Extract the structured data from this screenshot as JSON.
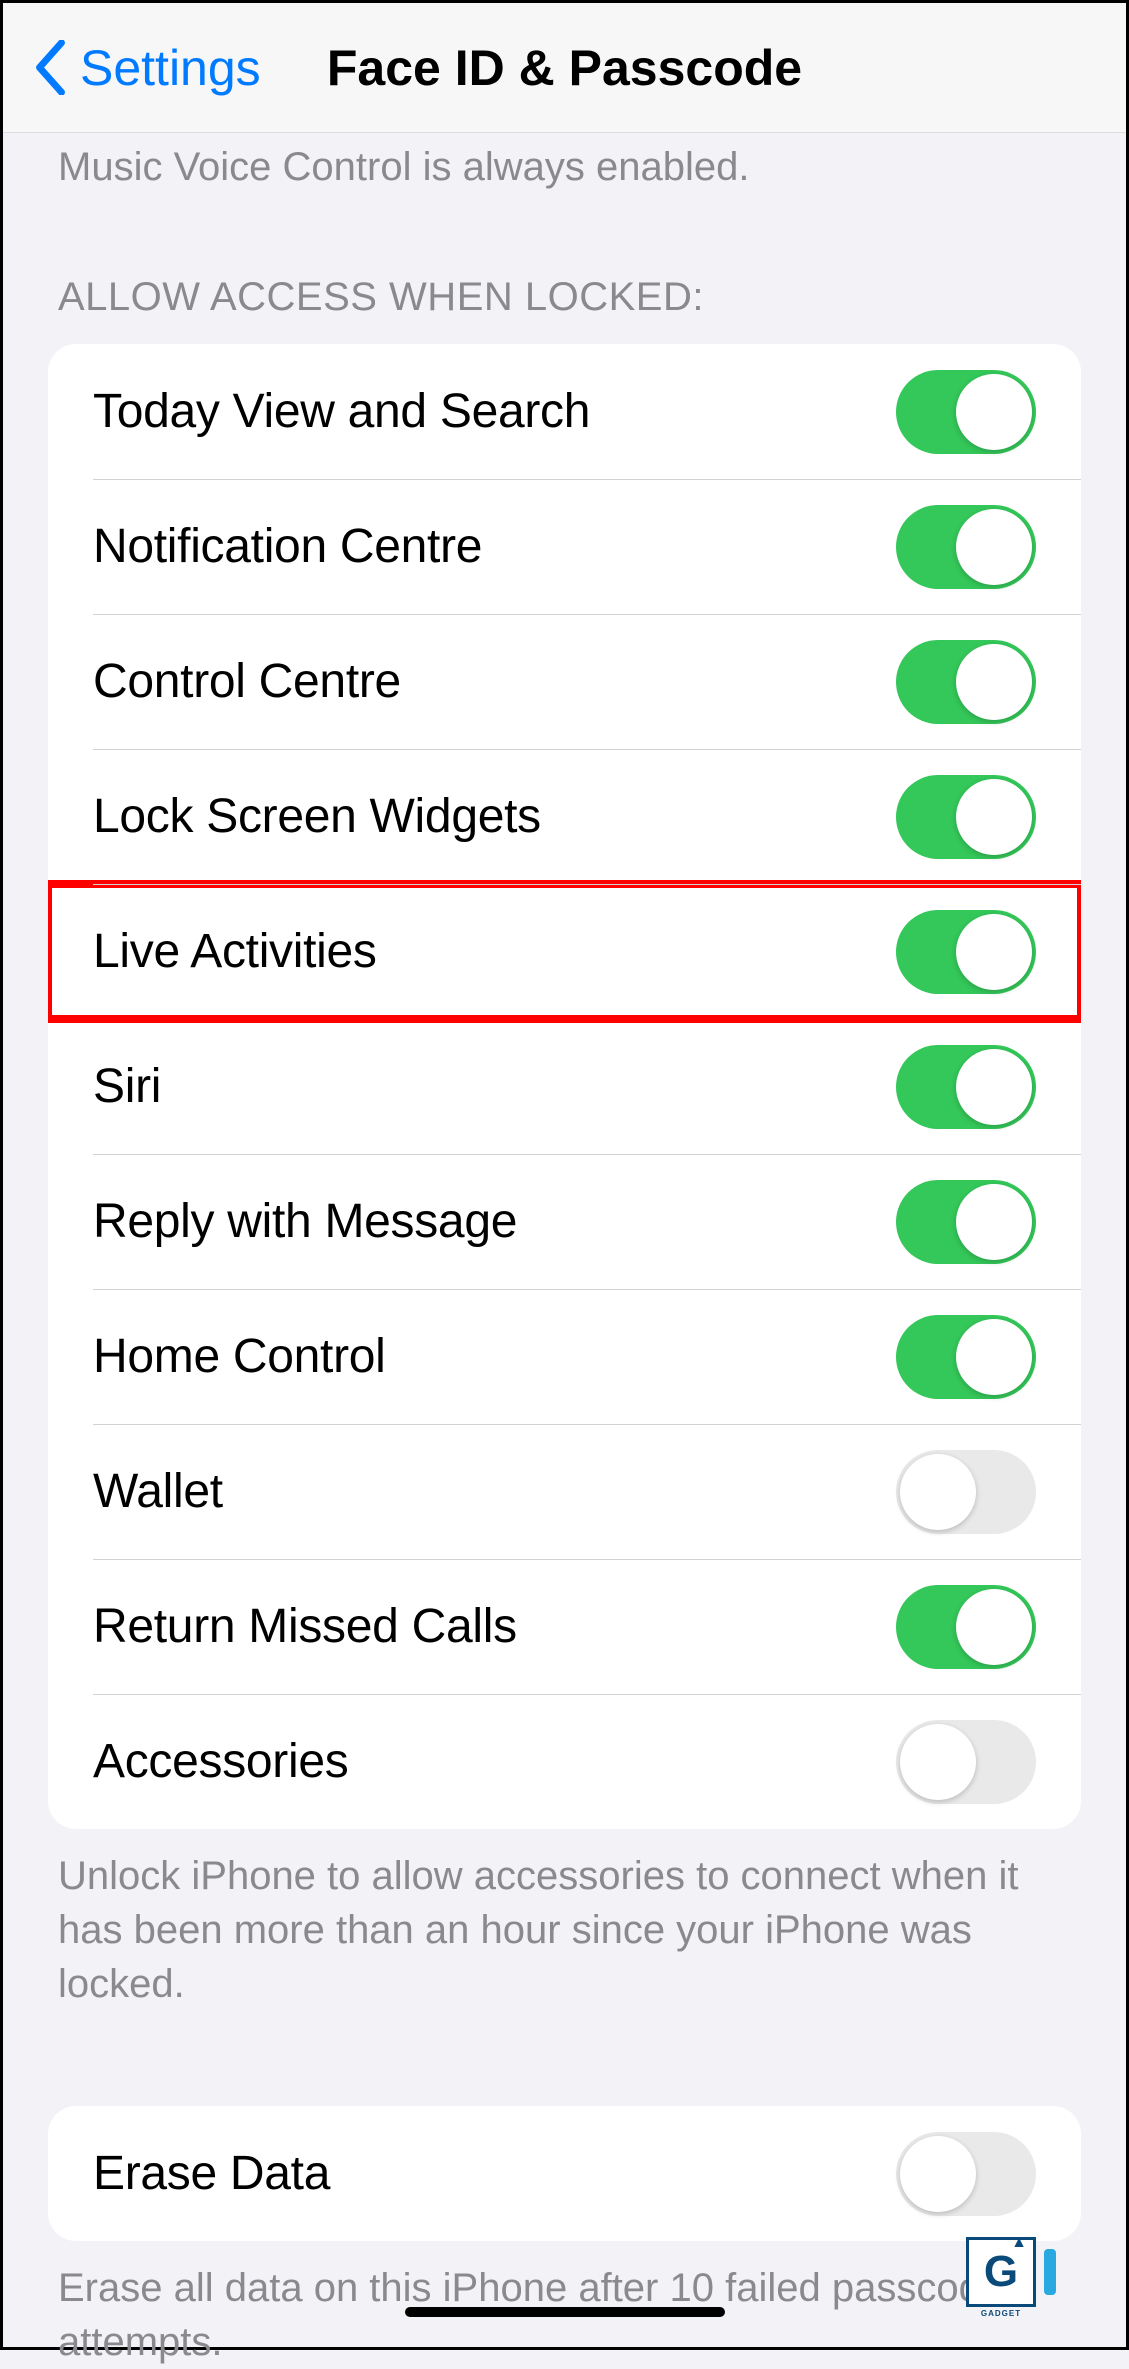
{
  "nav": {
    "back_label": "Settings",
    "title": "Face ID & Passcode"
  },
  "top_note": "Music Voice Control is always enabled.",
  "section_header": "Allow Access When Locked:",
  "access_items": [
    {
      "label": "Today View and Search",
      "enabled": true,
      "highlight": false
    },
    {
      "label": "Notification Centre",
      "enabled": true,
      "highlight": false
    },
    {
      "label": "Control Centre",
      "enabled": true,
      "highlight": false
    },
    {
      "label": "Lock Screen Widgets",
      "enabled": true,
      "highlight": false
    },
    {
      "label": "Live Activities",
      "enabled": true,
      "highlight": true
    },
    {
      "label": "Siri",
      "enabled": true,
      "highlight": false
    },
    {
      "label": "Reply with Message",
      "enabled": true,
      "highlight": false
    },
    {
      "label": "Home Control",
      "enabled": true,
      "highlight": false
    },
    {
      "label": "Wallet",
      "enabled": false,
      "highlight": false
    },
    {
      "label": "Return Missed Calls",
      "enabled": true,
      "highlight": false
    },
    {
      "label": "Accessories",
      "enabled": false,
      "highlight": false
    }
  ],
  "accessories_footer": "Unlock iPhone to allow accessories to connect when it has been more than an hour since your iPhone was locked.",
  "erase": {
    "label": "Erase Data",
    "enabled": false,
    "footer": "Erase all data on this iPhone after 10 failed passcode attempts."
  },
  "watermark": {
    "letter": "G",
    "brand": "GADGET"
  }
}
